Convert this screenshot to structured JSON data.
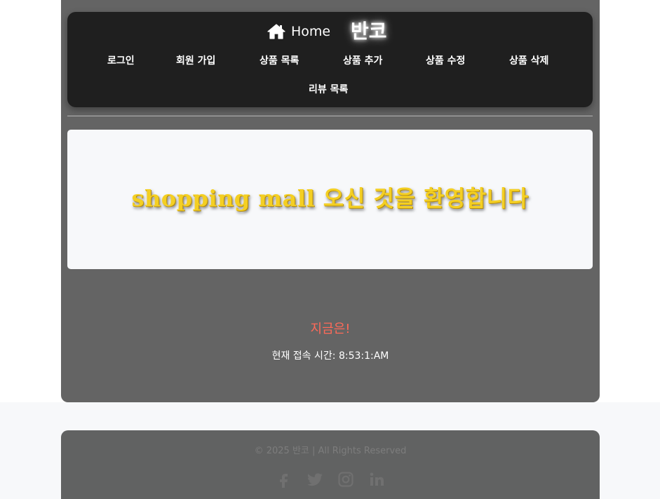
{
  "header": {
    "home_label": "Home",
    "brand": "반코",
    "nav_items": [
      {
        "label": "로그인"
      },
      {
        "label": "회원 가입"
      },
      {
        "label": "상품 목록"
      },
      {
        "label": "상품 추가"
      },
      {
        "label": "상품 수정"
      },
      {
        "label": "상품 삭제"
      },
      {
        "label": "리뷰 목록"
      }
    ]
  },
  "hero": {
    "welcome_text": "shopping mall 오신 것을 환영합니다"
  },
  "status": {
    "now_label": "지금은!",
    "access_time_text": "현재 접속 시간: 8:53:1:AM"
  },
  "footer": {
    "copyright": "© 2025 반코 | All Rights Reserved",
    "social_icons": [
      "facebook-icon",
      "twitter-icon",
      "instagram-icon",
      "linkedin-icon"
    ]
  },
  "colors": {
    "panel": "#646464",
    "navbar": "#1f1f1f",
    "hero_text": "#f4cf22",
    "now_label": "#ff6a59"
  }
}
